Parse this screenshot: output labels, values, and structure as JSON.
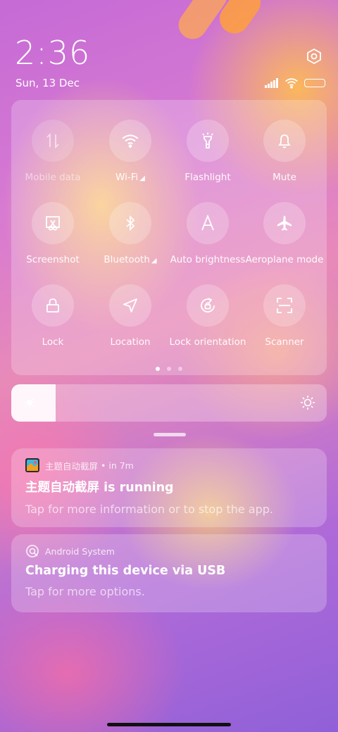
{
  "status_bar": {
    "time": "2:36",
    "date": "Sun, 13 Dec"
  },
  "quick_settings": {
    "tiles": [
      {
        "label": "Mobile data",
        "icon": "mobile-data-icon",
        "active": false
      },
      {
        "label": "Wi-Fi",
        "icon": "wifi-icon",
        "active": true,
        "has_arrow": true
      },
      {
        "label": "Flashlight",
        "icon": "flashlight-icon",
        "active": true
      },
      {
        "label": "Mute",
        "icon": "bell-icon",
        "active": true
      },
      {
        "label": "Screenshot",
        "icon": "screenshot-icon",
        "active": true
      },
      {
        "label": "Bluetooth",
        "icon": "bluetooth-icon",
        "active": true,
        "has_arrow": true
      },
      {
        "label": "Auto brightness",
        "icon": "auto-brightness-icon",
        "active": true
      },
      {
        "label": "Aeroplane mode",
        "icon": "airplane-icon",
        "active": true
      },
      {
        "label": "Lock",
        "icon": "lock-icon",
        "active": true
      },
      {
        "label": "Location",
        "icon": "location-icon",
        "active": true
      },
      {
        "label": "Lock orientation",
        "icon": "rotation-lock-icon",
        "active": true
      },
      {
        "label": "Scanner",
        "icon": "scanner-icon",
        "active": true
      }
    ],
    "page_count": 3,
    "current_page": 1
  },
  "brightness": {
    "level_fraction": 0.14
  },
  "notifications": [
    {
      "app": "主题自动截屏",
      "time": "in 7m",
      "title": "主题自动截屏 is running",
      "text": "Tap for more information or to stop the app."
    },
    {
      "app": "Android System",
      "title": "Charging this device via USB",
      "text": "Tap for more options."
    }
  ],
  "colors": {
    "panel_overlay": "#ffffff",
    "home_indicator": "#111111"
  }
}
